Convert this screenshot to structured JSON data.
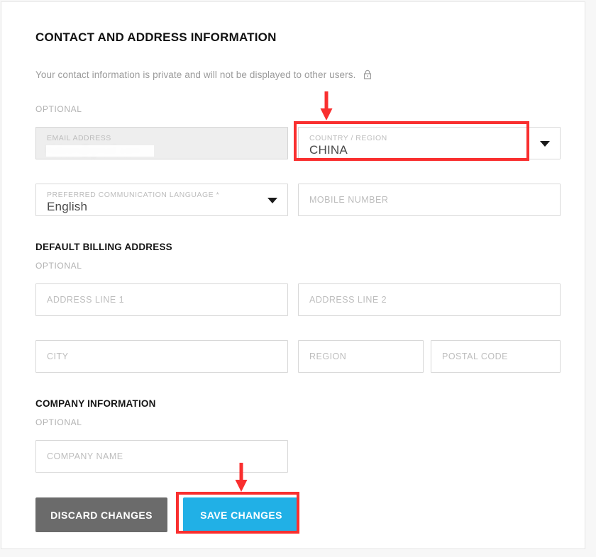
{
  "page": {
    "section_title": "CONTACT AND ADDRESS INFORMATION",
    "privacy_note": "Your contact information is private and will not be displayed to other users.",
    "lock_icon": "lock-icon",
    "optional_label_contact": "OPTIONAL",
    "optional_label_billing": "OPTIONAL",
    "optional_label_company": "OPTIONAL"
  },
  "colors": {
    "accent_save": "#21b0e6",
    "discard": "#6b6b6b",
    "annotation_red": "#f92f2f",
    "label_gray": "#bdbdbd",
    "disabled_bg": "#eeeeee"
  },
  "fields": {
    "email": {
      "label": "EMAIL ADDRESS",
      "value": "redacted",
      "placeholder": "EMAIL ADDRESS",
      "disabled": true
    },
    "country": {
      "label": "COUNTRY / REGION",
      "value": "CHINA",
      "placeholder": "COUNTRY / REGION",
      "icon": "chevron-down-icon",
      "highlighted": true
    },
    "language": {
      "label": "PREFERRED COMMUNICATION LANGUAGE *",
      "value": "English",
      "placeholder": "PREFERRED COMMUNICATION LANGUAGE *",
      "icon": "chevron-down-icon"
    },
    "mobile": {
      "label": "MOBILE NUMBER",
      "value": "",
      "placeholder": "MOBILE NUMBER"
    },
    "address_line_1": {
      "label": "ADDRESS LINE 1",
      "value": "",
      "placeholder": "ADDRESS LINE 1"
    },
    "address_line_2": {
      "label": "ADDRESS LINE 2",
      "value": "",
      "placeholder": "ADDRESS LINE 2"
    },
    "city": {
      "label": "CITY",
      "value": "",
      "placeholder": "CITY"
    },
    "region": {
      "label": "REGION",
      "value": "",
      "placeholder": "REGION"
    },
    "postal_code": {
      "label": "POSTAL CODE",
      "value": "",
      "placeholder": "POSTAL CODE"
    },
    "company_name": {
      "label": "COMPANY NAME",
      "value": "",
      "placeholder": "COMPANY NAME"
    }
  },
  "sections": {
    "billing": {
      "title": "DEFAULT BILLING ADDRESS"
    },
    "company": {
      "title": "COMPANY INFORMATION"
    }
  },
  "buttons": {
    "discard": "DISCARD CHANGES",
    "save": "SAVE CHANGES"
  },
  "annotations": {
    "arrow_country": "down-arrow-icon",
    "arrow_save": "down-arrow-icon"
  }
}
